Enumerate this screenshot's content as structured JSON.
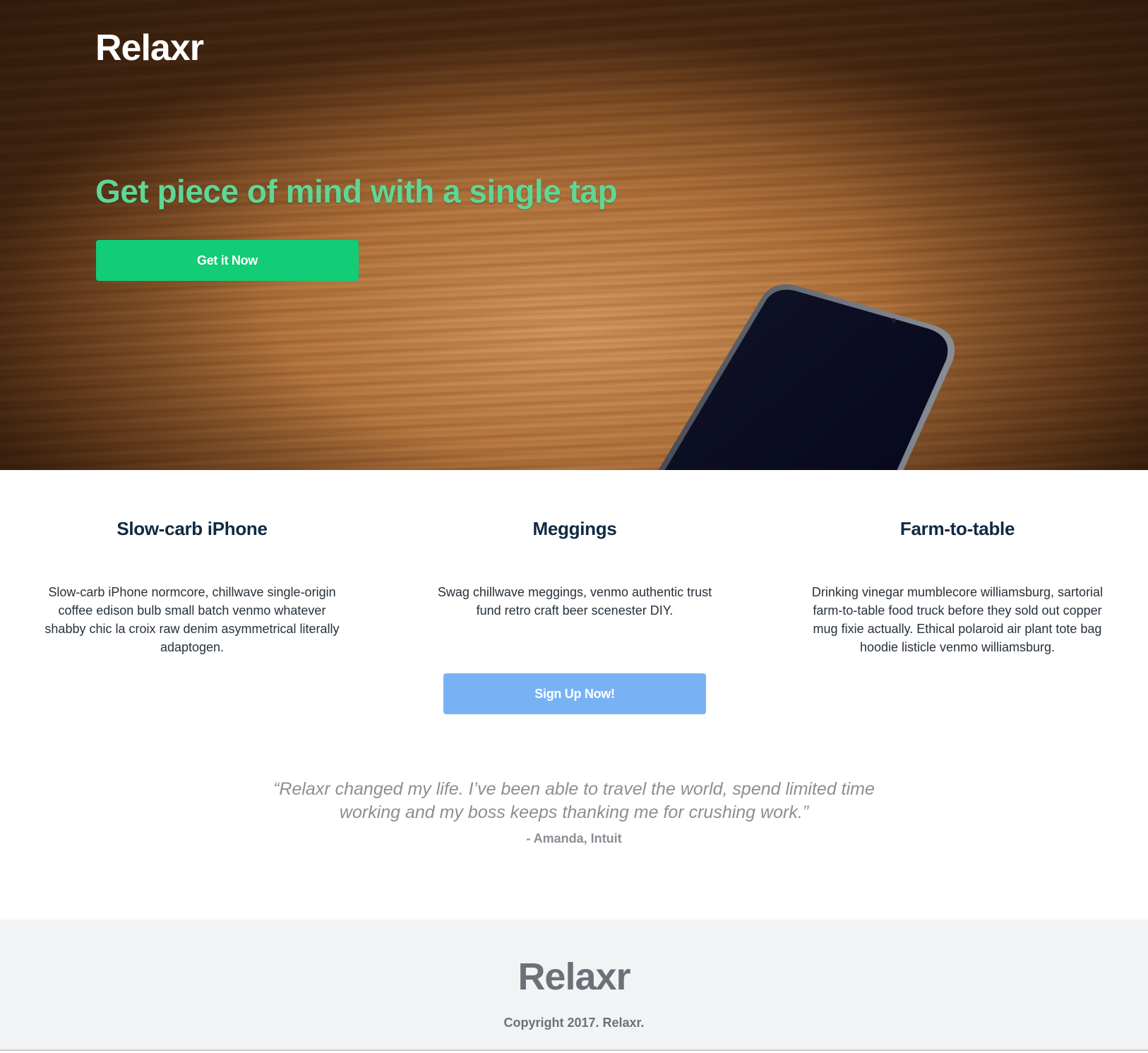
{
  "hero": {
    "brand": "Relaxr",
    "headline": "Get piece of mind with a single tap",
    "cta_label": "Get it Now"
  },
  "features": [
    {
      "title": "Slow-carb iPhone",
      "text": "Slow-carb iPhone normcore, chillwave single-origin coffee edison bulb small batch venmo whatever shabby chic la croix raw denim asymmetrical literally adaptogen."
    },
    {
      "title": "Meggings",
      "text": "Swag chillwave meggings, venmo authentic trust fund retro craft beer scenester DIY."
    },
    {
      "title": "Farm-to-table",
      "text": "Drinking vinegar mumblecore williamsburg, sartorial farm-to-table food truck before they sold out copper mug fixie actually. Ethical polaroid air plant tote bag hoodie listicle venmo williamsburg."
    }
  ],
  "signup": {
    "label": "Sign Up Now!"
  },
  "testimonial": {
    "quote": "“Relaxr changed my life. I’ve been able to travel the world, spend limited time working and my boss keeps thanking me for crushing work.”",
    "author": "- Amanda, Intuit"
  },
  "footer": {
    "brand": "Relaxr",
    "copyright": "Copyright 2017. Relaxr."
  },
  "colors": {
    "primary_button": "#12cc76",
    "secondary_button": "#78b2f5",
    "headline": "#5fd695",
    "heading_dark": "#0f2a43",
    "footer_bg": "#f2f3f4"
  }
}
